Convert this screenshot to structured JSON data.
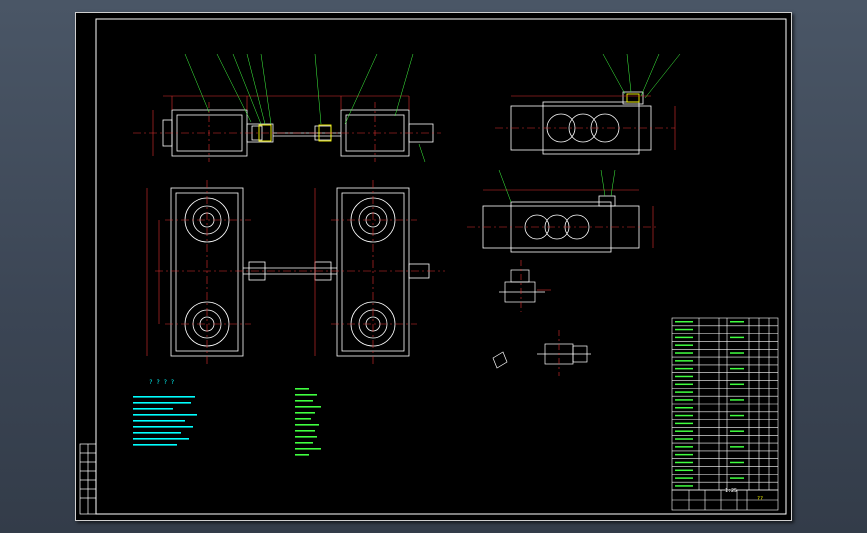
{
  "drawing": {
    "background": "#000000",
    "viewport_background": "#3f4a59",
    "frame_color": "#ffffff",
    "geometry_color": "#ffffff",
    "centerline_color": "#e03030",
    "dimension_color": "#e03030",
    "annotation_color": "#00ffff",
    "leader_color": "#40ff40",
    "highlight_color": "#ffff00"
  },
  "notes": {
    "heading": "? ? ? ?",
    "lines_count_left": 9,
    "lines_count_right": 12
  },
  "title_block": {
    "scale_text": "1:25",
    "tag_text": "??"
  }
}
